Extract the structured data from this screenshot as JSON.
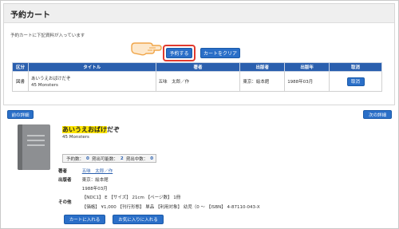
{
  "cart": {
    "title": "予約カート",
    "info": "予約カートに下記資料が入っています",
    "reserve_label": "予約する",
    "clear_label": "カートをクリア",
    "columns": [
      "区分",
      "タイトル",
      "著者",
      "出版者",
      "出版年",
      "取消"
    ],
    "rows": [
      {
        "category": "図書",
        "title_line1": "あいうえおばけだぞ",
        "title_line2": "45 Monsters",
        "author": "五味　太郎／作",
        "publisher": "東京：絵本館",
        "year": "1988年03月",
        "cancel_label": "取消"
      }
    ]
  },
  "nav": {
    "prev_label": "前の詳細",
    "next_label": "次の詳細"
  },
  "detail": {
    "title_highlight": "あいうえおばけ",
    "title_rest": "だぞ",
    "subtitle": "45 Monsters",
    "availability": {
      "reserve_label": "予約数：",
      "reserve_count": "0",
      "lendable_label": "貸出可能数：",
      "lendable_count": "2",
      "lent_label": "貸出中数：",
      "lent_count": "0"
    },
    "author_label": "著者",
    "author_value": "五味　太郎／作",
    "publisher_label": "出版者",
    "publisher_value": "東京：絵本館",
    "year_value": "1988年03月",
    "other_label": "その他",
    "other_line1": "【NDC1】 E 【サイズ】 21cm 【ページ数】 1冊",
    "other_line2": "【価格】 ¥1,000 【刊行形態】 単品 【利用対象】 幼児（0 ～ 【ISBN】 4-87110-043-X",
    "add_cart_label": "カートに入れる",
    "favorite_label": "お気に入りに入れる"
  },
  "colors": {
    "button_blue": "#2a6fc8",
    "header_blue": "#2a5fae",
    "highlight_yellow": "#ffe600",
    "callout_red": "#e23a2e",
    "hand_orange": "#f0a64a"
  }
}
